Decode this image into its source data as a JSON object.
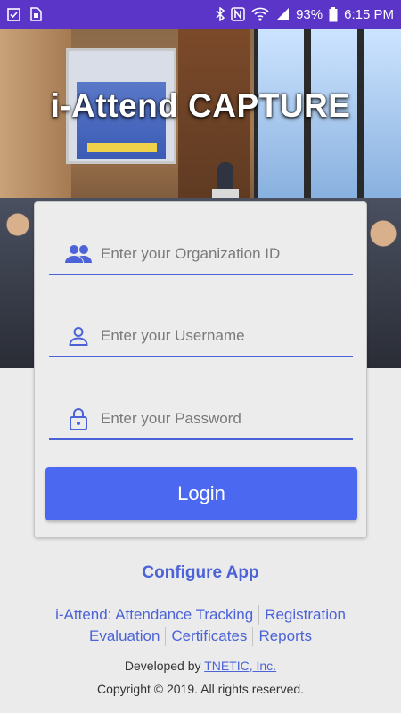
{
  "status_bar": {
    "battery": "93%",
    "time": "6:15 PM",
    "icons": [
      "checkbox-icon",
      "sim-icon",
      "bluetooth-icon",
      "nfc-icon",
      "wifi-icon",
      "signal-icon",
      "battery-icon"
    ],
    "background": "#5b35c8"
  },
  "app": {
    "title": "i-Attend CAPTURE"
  },
  "login_form": {
    "org_placeholder": "Enter your Organization ID",
    "username_placeholder": "Enter your Username",
    "password_placeholder": "Enter your Password",
    "org_icon": "group-icon",
    "user_icon": "person-icon",
    "password_icon": "lock-icon",
    "login_label": "Login",
    "accent_color": "#4b68f0"
  },
  "configure_label": "Configure App",
  "links": {
    "row1": [
      "i-Attend: Attendance Tracking",
      "Registration"
    ],
    "row2": [
      "Evaluation",
      "Certificates",
      "Reports"
    ]
  },
  "footer": {
    "developed_by": "Developed by",
    "company": "TNETIC, Inc.",
    "copyright": "Copyright © 2019. All rights reserved."
  }
}
